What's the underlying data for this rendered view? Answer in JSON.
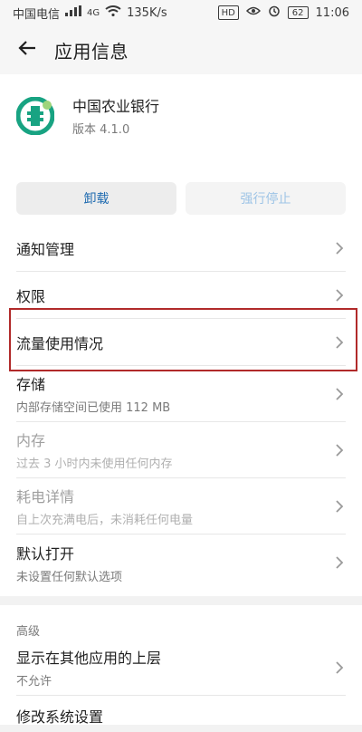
{
  "status": {
    "carrier": "中国电信",
    "network": "4G",
    "speed": "135K/s",
    "hd": "HD",
    "battery": "62",
    "time": "11:06"
  },
  "header": {
    "title": "应用信息"
  },
  "app": {
    "name": "中国农业银行",
    "version": "版本 4.1.0"
  },
  "buttons": {
    "uninstall": "卸载",
    "force_stop": "强行停止"
  },
  "list": [
    {
      "label": "通知管理",
      "sub": "",
      "dim": false
    },
    {
      "label": "权限",
      "sub": "",
      "dim": false
    },
    {
      "label": "流量使用情况",
      "sub": "",
      "dim": false
    },
    {
      "label": "存储",
      "sub": "内部存储空间已使用 112 MB",
      "dim": false
    },
    {
      "label": "内存",
      "sub": "过去 3 小时内未使用任何内存",
      "dim": true
    },
    {
      "label": "耗电详情",
      "sub": "自上次充满电后，未消耗任何电量",
      "dim": true
    },
    {
      "label": "默认打开",
      "sub": "未设置任何默认选项",
      "dim": false
    }
  ],
  "advanced": {
    "section": "高级",
    "items": [
      {
        "label": "显示在其他应用的上层",
        "sub": "不允许"
      },
      {
        "label": "修改系统设置",
        "sub": ""
      }
    ]
  },
  "colors": {
    "accent": "#1f6bb0",
    "highlight": "#b12a2a"
  }
}
